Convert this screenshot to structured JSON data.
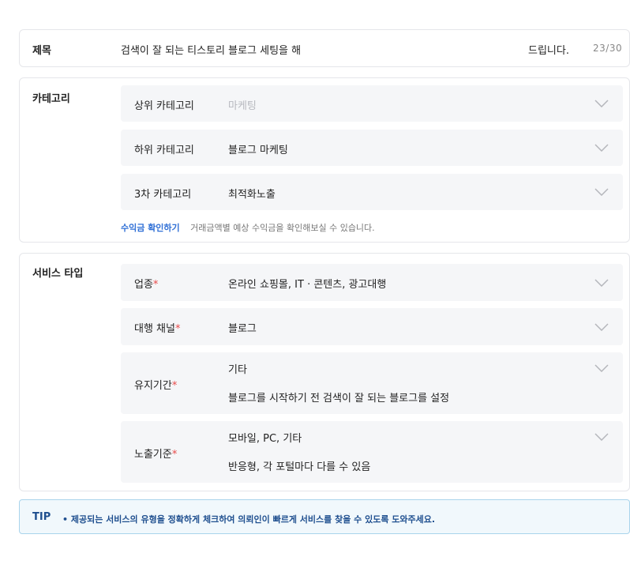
{
  "title": {
    "label": "제목",
    "value": "검색이 잘 되는 티스토리 블로그 세팅을 해",
    "value_tail": "드립니다.",
    "counter": "23/30"
  },
  "category": {
    "label": "카테고리",
    "top": {
      "label": "상위 카테고리",
      "value": "마케팅"
    },
    "sub": {
      "label": "하위 카테고리",
      "value": "블로그 마케팅"
    },
    "third": {
      "label": "3차 카테고리",
      "value": "최적화노출"
    },
    "profit_link": "수익금 확인하기",
    "profit_desc": "거래금액별 예상 수익금을 확인해보실 수 있습니다."
  },
  "service": {
    "label": "서비스 타입",
    "industry": {
      "label": "업종",
      "value": "온라인 쇼핑몰, IT · 콘텐츠, 광고대행"
    },
    "channel": {
      "label": "대행 채널",
      "value": "블로그"
    },
    "period": {
      "label": "유지기간",
      "value": "기타",
      "detail": "블로그를 시작하기 전 검색이 잘 되는 블로그를 설정"
    },
    "exposure": {
      "label": "노출기준",
      "value": "모바일, PC, 기타",
      "detail": "반응형, 각 포털마다 다를 수 있음"
    },
    "required_mark": "*"
  },
  "tip": {
    "title": "TIP",
    "text": "• 제공되는 서비스의 유형을 정확하게 체크하여 의뢰인이 빠르게 서비스를 찾을 수 있도록 도와주세요."
  },
  "colors": {
    "accent": "#2f6fd6",
    "required": "#e84a4a",
    "tip_bg": "#f1f8fc",
    "tip_border": "#a9d4ec",
    "tip_text": "#1f4f8f",
    "select_bg": "#f5f6f8"
  },
  "icons": {
    "dropdown": "chevron-down-icon"
  }
}
